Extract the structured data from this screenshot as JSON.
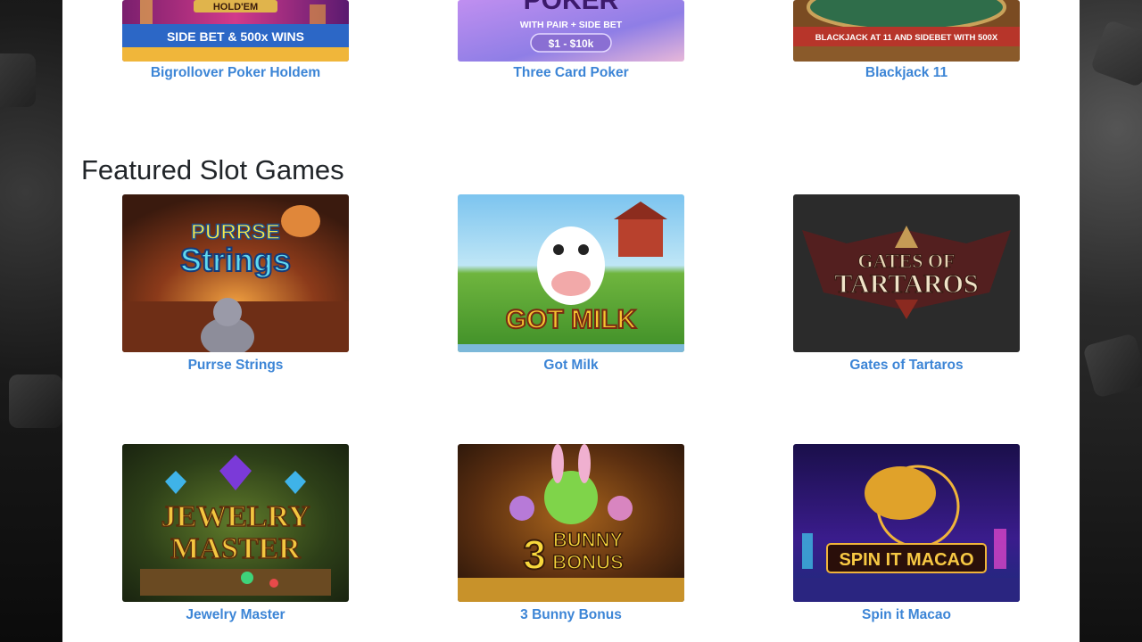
{
  "table_games": [
    {
      "name": "Bigrollover Poker Holdem",
      "art_lines": [
        "HOLD'EM",
        "SIDE BET & 500x WINS"
      ],
      "icon": "poker-holdem-thumbnail"
    },
    {
      "name": "Three Card Poker",
      "art_lines": [
        "POKER",
        "WITH PAIR + SIDE BET",
        "$1 - $10k"
      ],
      "icon": "three-card-poker-thumbnail"
    },
    {
      "name": "Blackjack 11",
      "art_lines": [
        "BLACKJACK AT 11 AND SIDEBET WITH 500X"
      ],
      "icon": "blackjack-thumbnail"
    }
  ],
  "featured_section": {
    "title": "Featured Slot Games"
  },
  "slot_games": [
    {
      "name": "Purrse Strings",
      "art_lines": [
        "PURRSE",
        "Strings"
      ],
      "icon": "purrse-strings-thumbnail"
    },
    {
      "name": "Got Milk",
      "art_lines": [
        "GOT MILK"
      ],
      "icon": "got-milk-thumbnail"
    },
    {
      "name": "Gates of Tartaros",
      "art_lines": [
        "GATES OF",
        "TARTAROS"
      ],
      "icon": "gates-of-tartaros-thumbnail"
    },
    {
      "name": "Jewelry Master",
      "art_lines": [
        "JEWELRY",
        "MASTER"
      ],
      "icon": "jewelry-master-thumbnail"
    },
    {
      "name": "3 Bunny Bonus",
      "art_lines": [
        "3",
        "BUNNY",
        "BONUS"
      ],
      "icon": "bunny-bonus-thumbnail"
    },
    {
      "name": "Spin it Macao",
      "art_lines": [
        "SPIN IT MACAO"
      ],
      "icon": "spin-it-macao-thumbnail"
    }
  ],
  "colors": {
    "link": "#3c85d6",
    "heading": "#212529",
    "page_bg": "#ffffff",
    "backdrop": "#151515"
  }
}
